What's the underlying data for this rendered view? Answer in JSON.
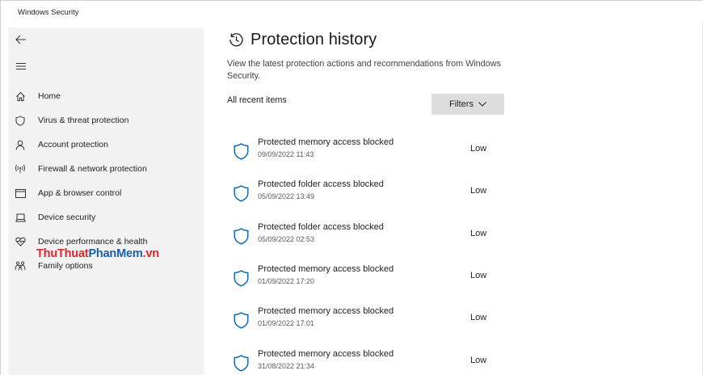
{
  "window": {
    "title": "Windows Security"
  },
  "sidebar": {
    "items": [
      {
        "label": "Home",
        "icon": "home-icon"
      },
      {
        "label": "Virus & threat protection",
        "icon": "shield-outline-icon"
      },
      {
        "label": "Account protection",
        "icon": "person-icon"
      },
      {
        "label": "Firewall & network protection",
        "icon": "wifi-antenna-icon"
      },
      {
        "label": "App & browser control",
        "icon": "browser-window-icon"
      },
      {
        "label": "Device security",
        "icon": "laptop-icon"
      },
      {
        "label": "Device performance & health",
        "icon": "heart-pulse-icon"
      },
      {
        "label": "Family options",
        "icon": "family-icon"
      }
    ]
  },
  "watermark": {
    "part1": "ThuThuat",
    "part2": "PhanMem",
    "part3": ".vn"
  },
  "main": {
    "title": "Protection history",
    "description": "View the latest protection actions and recommendations from Windows Security.",
    "recent_label": "All recent items",
    "filters_label": "Filters",
    "history": [
      {
        "title": "Protected memory access blocked",
        "timestamp": "09/09/2022 11:43",
        "severity": "Low"
      },
      {
        "title": "Protected folder access blocked",
        "timestamp": "05/09/2022 13:49",
        "severity": "Low"
      },
      {
        "title": "Protected folder access blocked",
        "timestamp": "05/09/2022 02:53",
        "severity": "Low"
      },
      {
        "title": "Protected memory access blocked",
        "timestamp": "01/09/2022 17:20",
        "severity": "Low"
      },
      {
        "title": "Protected memory access blocked",
        "timestamp": "01/09/2022 17:01",
        "severity": "Low"
      },
      {
        "title": "Protected memory access blocked",
        "timestamp": "31/08/2022 21:34",
        "severity": "Low"
      }
    ]
  },
  "colors": {
    "accent": "#0063b1",
    "sidebar_bg": "#f2f2f2",
    "filters_bg": "#dddddd",
    "watermark_red": "#d8282b",
    "watermark_blue": "#1b5fa8"
  }
}
